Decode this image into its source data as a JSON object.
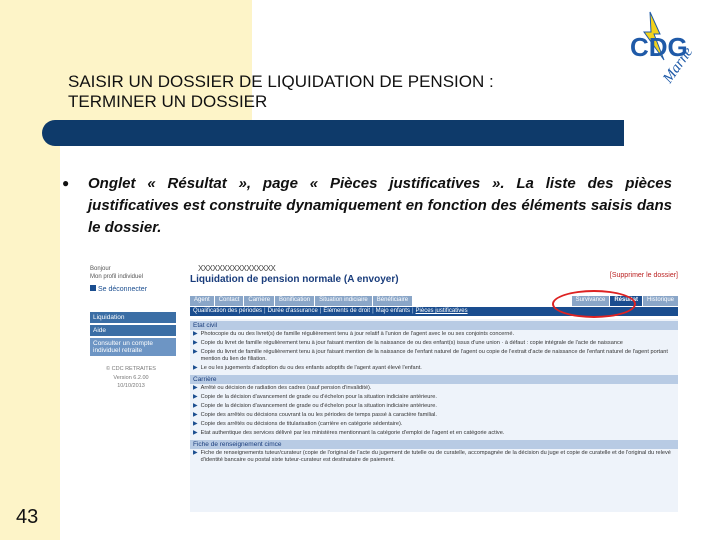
{
  "slide": {
    "title_line1": "SAISIR UN DOSSIER DE LIQUIDATION DE PENSION :",
    "title_line2": "TERMINER UN DOSSIER",
    "bullet_text": "Onglet « Résultat », page « Pièces justificatives ». La liste des pièces justificatives est construite dynamiquement en fonction des éléments saisis dans le dossier.",
    "page_number": "43",
    "logo_text": "CDG",
    "logo_subtext": "Marne",
    "colors": {
      "title_bar": "#0e3a6a",
      "accent_band": "#fdf4c8",
      "logo_blue": "#1f5aa8",
      "logo_yellow": "#f2d21b"
    }
  },
  "screenshot": {
    "sidebar": {
      "greeting": "Bonjour",
      "subline": "Mon profil individuel",
      "logout": "Se déconnecter",
      "menu": [
        {
          "label": "Liquidation",
          "type": "main"
        },
        {
          "label": "Aide",
          "type": "main"
        },
        {
          "label": "Consulter un compte individuel retraite",
          "type": "sub"
        }
      ],
      "footer": [
        "© CDC RETRAITES",
        "Version 6.2.00",
        "10/10/2013"
      ]
    },
    "main": {
      "masked_name": "XXXXXXXXXXXXXXXX",
      "title": "Liquidation de pension normale (A envoyer)",
      "delete_link": "[Supprimer le dossier]",
      "tabs": [
        "Agent",
        "Contact",
        "Carrière",
        "Bonification",
        "Situation indiciaire",
        "Bénéficiaire",
        "Survivance",
        "Résultat",
        "Historique"
      ],
      "active_tab": "Résultat",
      "subtabs": [
        "Qualification des périodes",
        "Durée d'assurance",
        "Éléments de droit",
        "Majo enfants",
        "Pièces justificatives"
      ],
      "sections": [
        {
          "title": "Etat civil",
          "items": [
            "Photocopie du ou des livret(s) de famille régulièrement tenu à jour relatif à l'union de l'agent avec le ou ses conjoints concerné.",
            "Copie du livret de famille régulièrement tenu à jour faisant mention de la naissance de ou des enfant(s) issus d'une union · à défaut : copie intégrale de l'acte de naissance",
            "Copie du livret de famille régulièrement tenu à jour faisant mention de la naissance de l'enfant naturel de l'agent ou copie de l'extrait d'acte de naissance de l'enfant naturel de l'agent portant mention du lien de filiation.",
            "Le ou les jugements d'adoption du ou des enfants adoptifs de l'agent ayant élevé l'enfant."
          ]
        },
        {
          "title": "Carrière",
          "items": [
            "Arrêté ou décision de radiation des cadres (sauf pension d'invalidité).",
            "Copie de la décision d'avancement de grade ou d'échelon pour la situation indiciaire antérieure.",
            "Copie de la décision d'avancement de grade ou d'échelon pour la situation indiciaire antérieure.",
            "Copie des arrêtés ou décisions couvrant la ou les périodes de temps passé à caractère familial.",
            "Copie des arrêtés ou décisions de titularisation (carrière en catégorie sédentaire).",
            "Etat authentique des services délivré par les ministères mentionnant la catégorie d'emploi de l'agent et en catégorie active."
          ]
        },
        {
          "title": "Fiche de renseignement cimce",
          "items": [
            "Fiche de renseignements tuteur/curateur (copie de l'original de l'acte du jugement de tutelle ou de curatelle, accompagnée de la décision du juge et copie de curatelle et de l'original du relevé d'identité bancaire ou postal sixte tuteur-curateur est destinataire de paiement."
          ]
        }
      ]
    }
  }
}
